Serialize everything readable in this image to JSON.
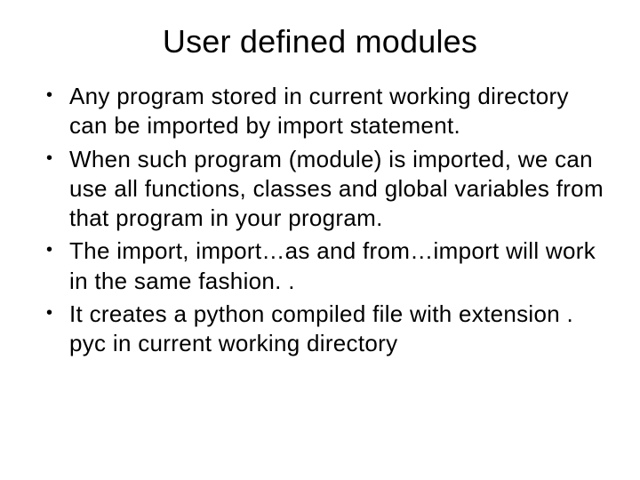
{
  "title": "User defined modules",
  "bullets": [
    "Any program stored in current working directory can be imported by import statement.",
    "When such program (module) is imported, we  can use all functions, classes and global  variables from that program in your program.",
    "The import, import…as and from…import will  work in the same fashion. .",
    "It creates a python compiled file with extension . pyc in current working directory"
  ]
}
